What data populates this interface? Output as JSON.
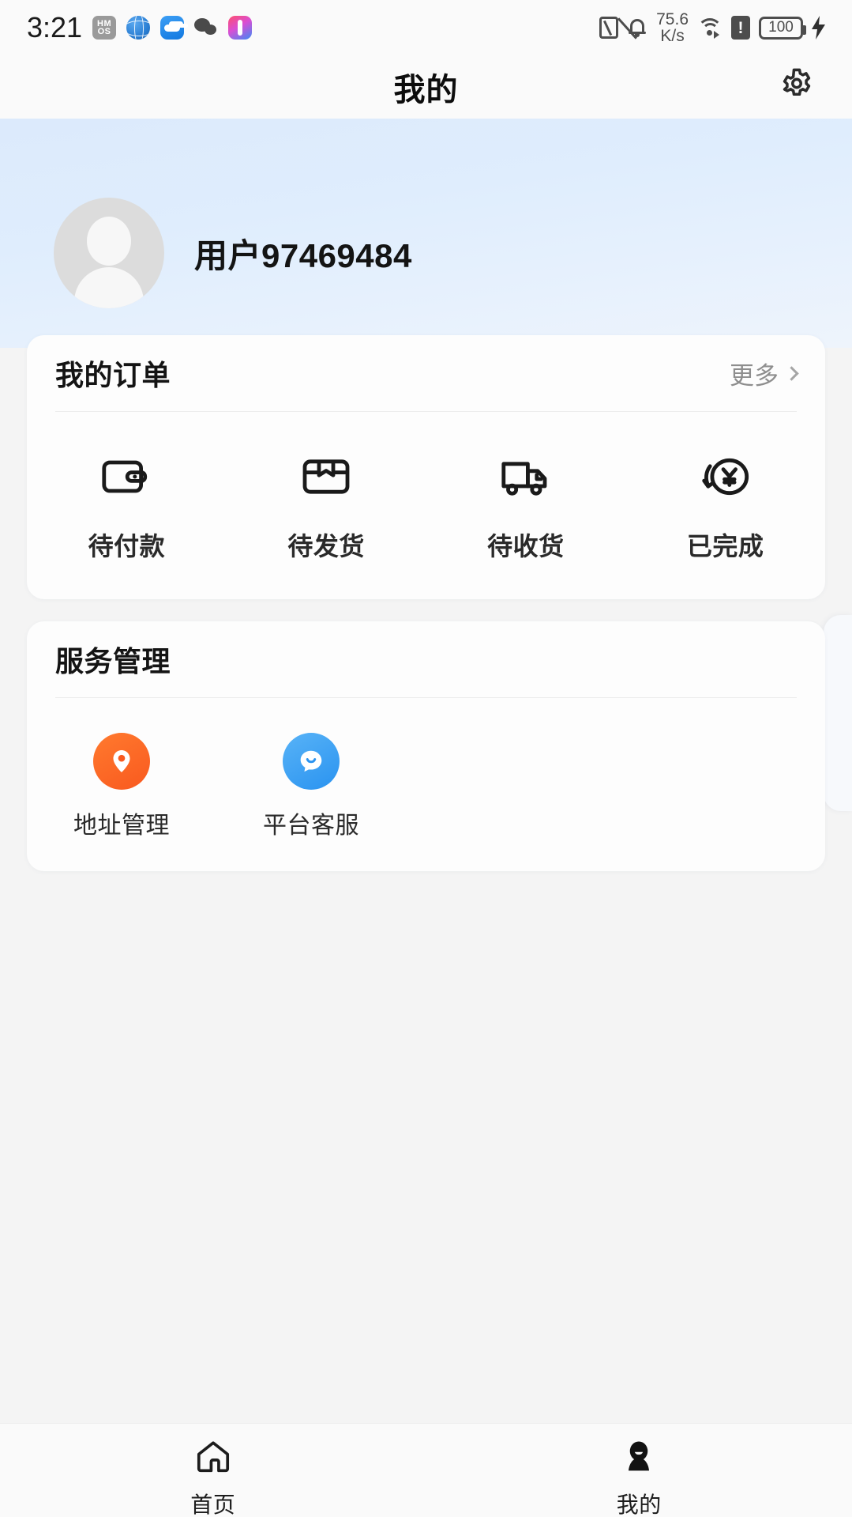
{
  "statusbar": {
    "time": "3:21",
    "left_icons": [
      "hmos-icon",
      "globe-icon",
      "cloud-icon",
      "wechat-icon",
      "app-icon"
    ],
    "hmos_line1": "HM",
    "hmos_line2": "OS",
    "network_speed_value": "75.6",
    "network_speed_unit": "K/s",
    "battery_level": "100",
    "right_icons": [
      "nfc-icon",
      "bell-muted-icon",
      "wifi-icon",
      "sim-alert-icon",
      "battery-icon",
      "charging-bolt-icon"
    ]
  },
  "header": {
    "title": "我的",
    "settings_icon": "gear-icon"
  },
  "profile": {
    "username": "用户97469484",
    "avatar_icon": "default-avatar-icon"
  },
  "orders": {
    "title": "我的订单",
    "more_label": "更多",
    "more_icon": "chevron-right-icon",
    "items": [
      {
        "label": "待付款",
        "icon": "wallet-icon"
      },
      {
        "label": "待发货",
        "icon": "package-box-icon"
      },
      {
        "label": "待收货",
        "icon": "delivery-truck-icon"
      },
      {
        "label": "已完成",
        "icon": "yuan-refund-icon"
      }
    ]
  },
  "service": {
    "title": "服务管理",
    "items": [
      {
        "label": "地址管理",
        "icon": "location-pin-icon",
        "color": "#f9591f"
      },
      {
        "label": "平台客服",
        "icon": "customer-service-icon",
        "color": "#2a93f0"
      }
    ]
  },
  "bottomnav": {
    "items": [
      {
        "label": "首页",
        "icon": "home-icon",
        "active": false
      },
      {
        "label": "我的",
        "icon": "profile-person-icon",
        "active": true
      }
    ]
  },
  "colors": {
    "hero_gradient_start": "#dceafc",
    "hero_gradient_end": "#eef4fc",
    "card_bg": "#fdfdfd",
    "page_bg": "#f4f4f4",
    "accent_orange": "#f9591f",
    "accent_blue": "#2a93f0"
  }
}
